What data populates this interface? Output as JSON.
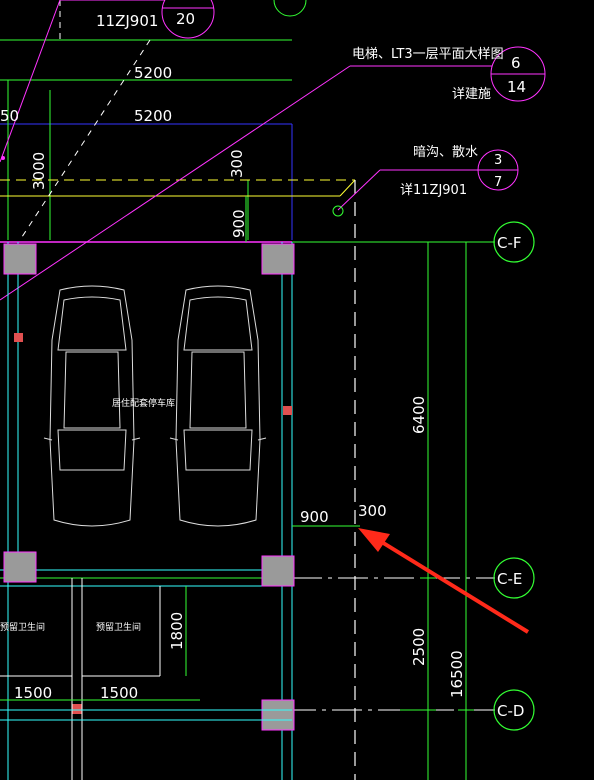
{
  "drawing": {
    "refs": {
      "top_ref_code": "11ZJ901",
      "top_ref_num": "20",
      "elevator_note": "电梯、LT3一层平面大样图",
      "elevator_note_sub": "详建施",
      "elevator_bubble": [
        "6",
        "14"
      ],
      "drain_note": "暗沟、散水",
      "drain_note_sub": "详11ZJ901",
      "drain_bubble": [
        "3",
        "7"
      ]
    },
    "dimensions": {
      "top_5200_a": "5200",
      "top_5200_b": "5200",
      "left_50": "50",
      "v_3000": "3000",
      "v_300_top": "300",
      "v_900_top": "900",
      "h_900": "900",
      "h_300": "300",
      "v_6400": "6400",
      "v_2500": "2500",
      "v_16500": "16500",
      "v_1800": "1800",
      "h_1500_a": "1500",
      "h_1500_b": "1500"
    },
    "axes": [
      "C-F",
      "C-E",
      "C-D"
    ],
    "rooms": {
      "garage": "居住配套停车库",
      "toilet_a": "预留卫生间",
      "toilet_b": "预留卫生间"
    },
    "colors": {
      "background": "#000000",
      "grid_green": "#33ff33",
      "magenta": "#ff33ff",
      "cyan": "#33ffff",
      "yellow": "#ffff33",
      "blue": "#3333ff",
      "column_gray": "#9a9a9a",
      "arrow_red": "#ff2a1a"
    }
  }
}
